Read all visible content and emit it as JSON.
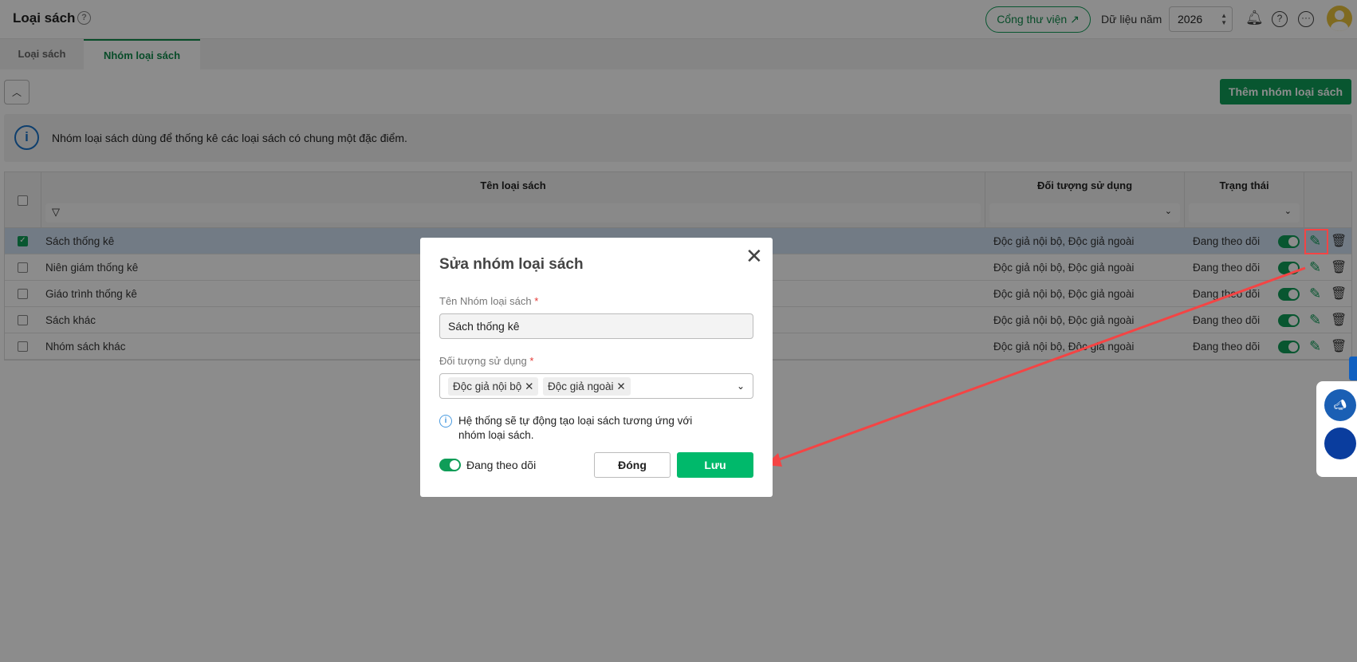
{
  "header": {
    "title": "Loại sách",
    "portal_label": "Cổng thư viện",
    "year_label": "Dữ liệu năm",
    "year_value": "2026"
  },
  "tabs": [
    {
      "label": "Loại sách"
    },
    {
      "label": "Nhóm loại sách",
      "active": true
    }
  ],
  "toolbar": {
    "add_label": "Thêm nhóm loại sách"
  },
  "banner": {
    "text": "Nhóm loại sách dùng để thống kê các loại sách có chung một đặc điểm."
  },
  "table": {
    "columns": [
      "Tên loại sách",
      "Đối tượng sử dụng",
      "Trạng thái"
    ],
    "rows": [
      {
        "name": "Sách thống kê",
        "audience": "Độc giả nội bộ, Độc giả ngoài",
        "status": "Đang theo dõi",
        "selected": true
      },
      {
        "name": "Niên giám thống kê",
        "audience": "Độc giả nội bộ, Độc giả ngoài",
        "status": "Đang theo dõi"
      },
      {
        "name": "Giáo trình thống kê",
        "audience": "Độc giả nội bộ, Độc giả ngoài",
        "status": "Đang theo dõi"
      },
      {
        "name": "Sách khác",
        "audience": "Độc giả nội bộ, Độc giả ngoài",
        "status": "Đang theo dõi"
      },
      {
        "name": "Nhóm sách khác",
        "audience": "Độc giả nội bộ, Độc giả ngoài",
        "status": "Đang theo dõi"
      }
    ]
  },
  "modal": {
    "title": "Sửa nhóm loại sách",
    "name_label": "Tên Nhóm loại sách",
    "name_value": "Sách thống kê",
    "audience_label": "Đối tượng sử dụng",
    "audience_chips": [
      "Độc giả nội bộ",
      "Độc giả ngoài"
    ],
    "required_mark": "*",
    "note": "Hệ thống sẽ tự động tạo loại sách tương ứng với nhóm loại sách.",
    "toggle_label": "Đang theo dõi",
    "close_label": "Đóng",
    "save_label": "Lưu"
  },
  "colors": {
    "accent": "#0f9d58",
    "annotation": "#f44444"
  }
}
